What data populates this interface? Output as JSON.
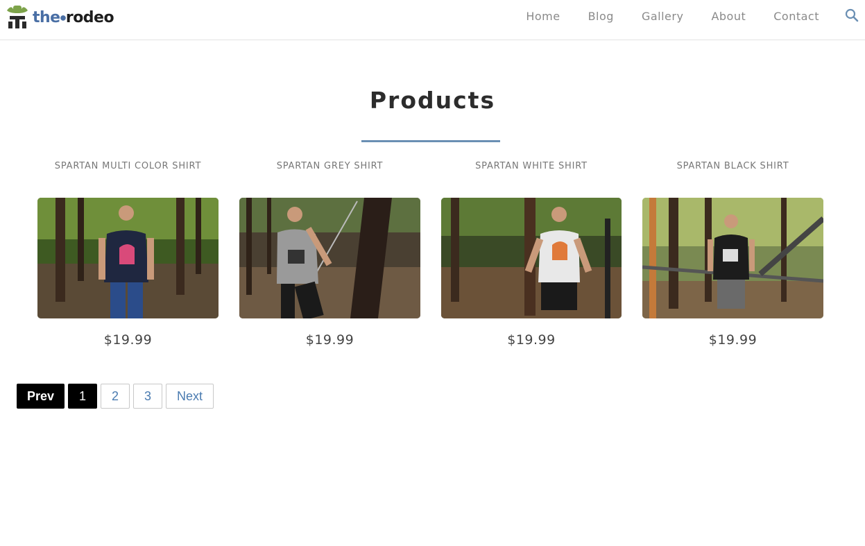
{
  "brand": {
    "name_part1": "the",
    "name_part2": "rodeo",
    "accent": "#4a6fa5"
  },
  "nav": {
    "items": [
      "Home",
      "Blog",
      "Gallery",
      "About",
      "Contact"
    ],
    "search_icon": "search-icon"
  },
  "page": {
    "title": "Products",
    "rule_color": "#6a8fb3"
  },
  "products": [
    {
      "name": "SPARTAN MULTI COLOR SHIRT",
      "price": "$19.99",
      "shirt_color": "#1f2740"
    },
    {
      "name": "SPARTAN GREY SHIRT",
      "price": "$19.99",
      "shirt_color": "#9a9a9a"
    },
    {
      "name": "SPARTAN WHITE SHIRT",
      "price": "$19.99",
      "shirt_color": "#e8e8e8"
    },
    {
      "name": "SPARTAN BLACK SHIRT",
      "price": "$19.99",
      "shirt_color": "#1c1c1c"
    }
  ],
  "pagination": {
    "prev": "Prev",
    "pages": [
      "1",
      "2",
      "3"
    ],
    "current": "1",
    "next": "Next"
  }
}
